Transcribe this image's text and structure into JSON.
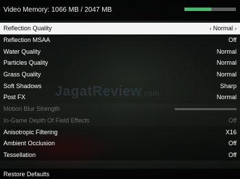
{
  "header": {
    "vram_label": "Video Memory: 1066 MB / 2047 MB",
    "vram_usage_fraction": 0.52,
    "vram_bar_color": "#49b86a"
  },
  "selected_value": {
    "left_arrow": "‹",
    "value": "Normal",
    "right_arrow": "›"
  },
  "settings": [
    {
      "label": "Reflection Quality",
      "value": "Normal"
    },
    {
      "label": "Reflection MSAA",
      "value": "Off"
    },
    {
      "label": "Water Quality",
      "value": "Normal"
    },
    {
      "label": "Particles Quality",
      "value": "Normal"
    },
    {
      "label": "Grass Quality",
      "value": "Normal"
    },
    {
      "label": "Soft Shadows",
      "value": "Sharp"
    },
    {
      "label": "Post FX",
      "value": "Normal"
    },
    {
      "label": "Motion Blur Strength",
      "value": ""
    },
    {
      "label": "In-Game Depth Of Field Effects",
      "value": "Off"
    },
    {
      "label": "Anisotropic Filtering",
      "value": "X16"
    },
    {
      "label": "Ambient Occlusion",
      "value": "Off"
    },
    {
      "label": "Tessellation",
      "value": "Off"
    }
  ],
  "footer": {
    "restore_label": "Restore Defaults"
  },
  "watermark": {
    "part1": "Jagat",
    "part2": "Review",
    "part3": ".com"
  }
}
